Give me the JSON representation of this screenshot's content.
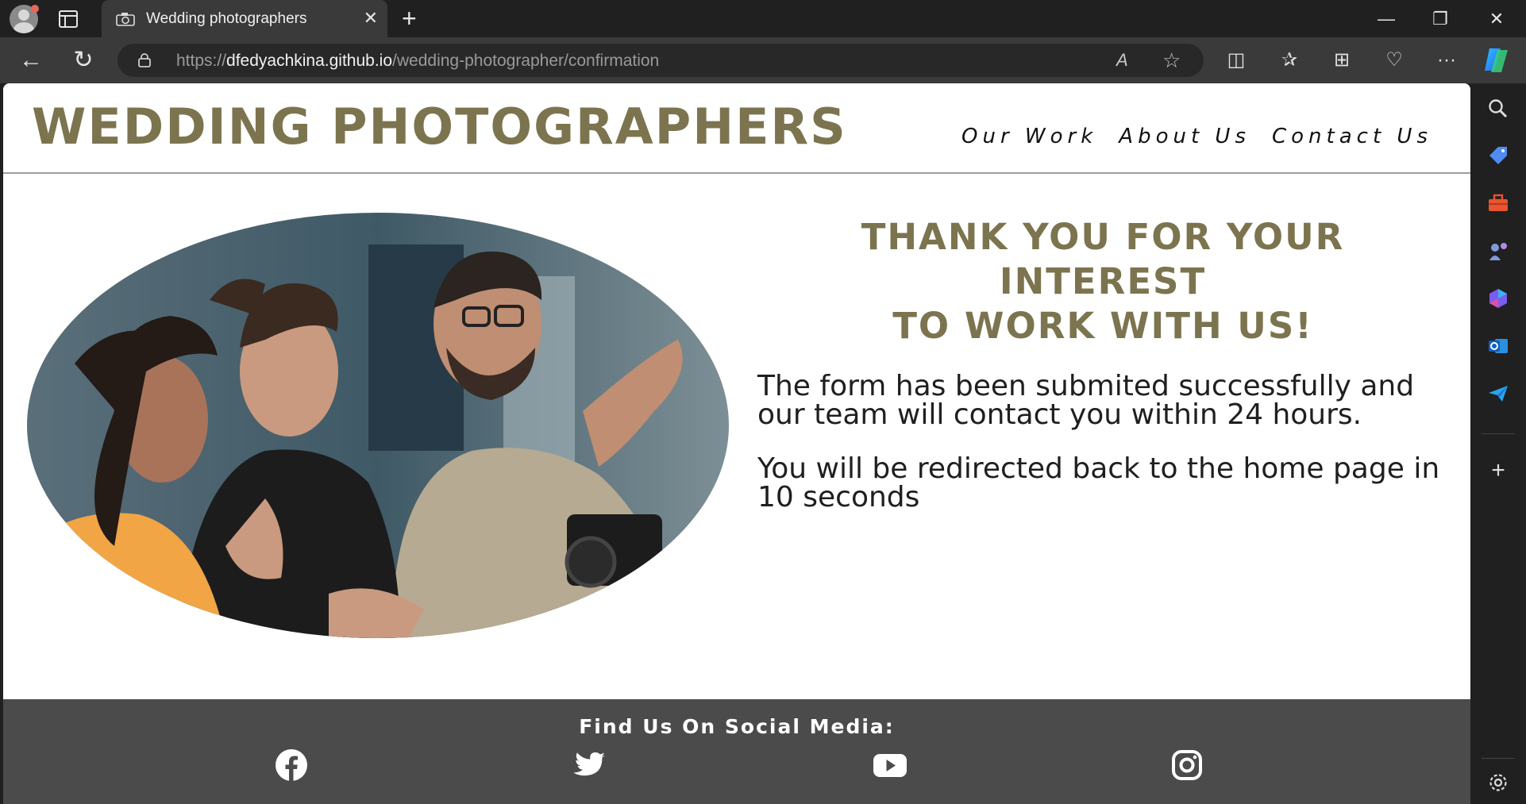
{
  "browser": {
    "tab_title": "Wedding photographers",
    "tab_close": "✕",
    "new_tab": "+",
    "url_prefix": "https://",
    "url_domain": "dfedyachkina.github.io",
    "url_path": "/wedding-photographer/confirmation",
    "window": {
      "minimize": "—",
      "restore": "❐",
      "close": "✕"
    },
    "nav": {
      "back": "←",
      "refresh": "↻"
    },
    "toolbar": {
      "read_aloud": "A",
      "favorite": "☆",
      "split": "◫",
      "favorites": "✰",
      "collections": "⊞",
      "health": "♡",
      "more": "···"
    },
    "sidebar_add": "+"
  },
  "site": {
    "logo": "WEDDING PHOTOGRAPHERS",
    "nav": [
      "Our Work",
      "About Us",
      "Contact Us"
    ],
    "heading_line1": "THANK YOU FOR YOUR INTEREST",
    "heading_line2": "TO WORK WITH US!",
    "message1": "The form has been submited successfully and our team will contact you within 24 hours.",
    "message2": "You will be redirected back to the home page in 10 seconds",
    "footer_title": "Find Us On Social Media:",
    "social": [
      "facebook-icon",
      "twitter-icon",
      "youtube-icon",
      "instagram-icon"
    ]
  },
  "colors": {
    "brand": "#7c744f",
    "footer_bg": "#4b4b4b",
    "chrome_bg": "#202020"
  }
}
